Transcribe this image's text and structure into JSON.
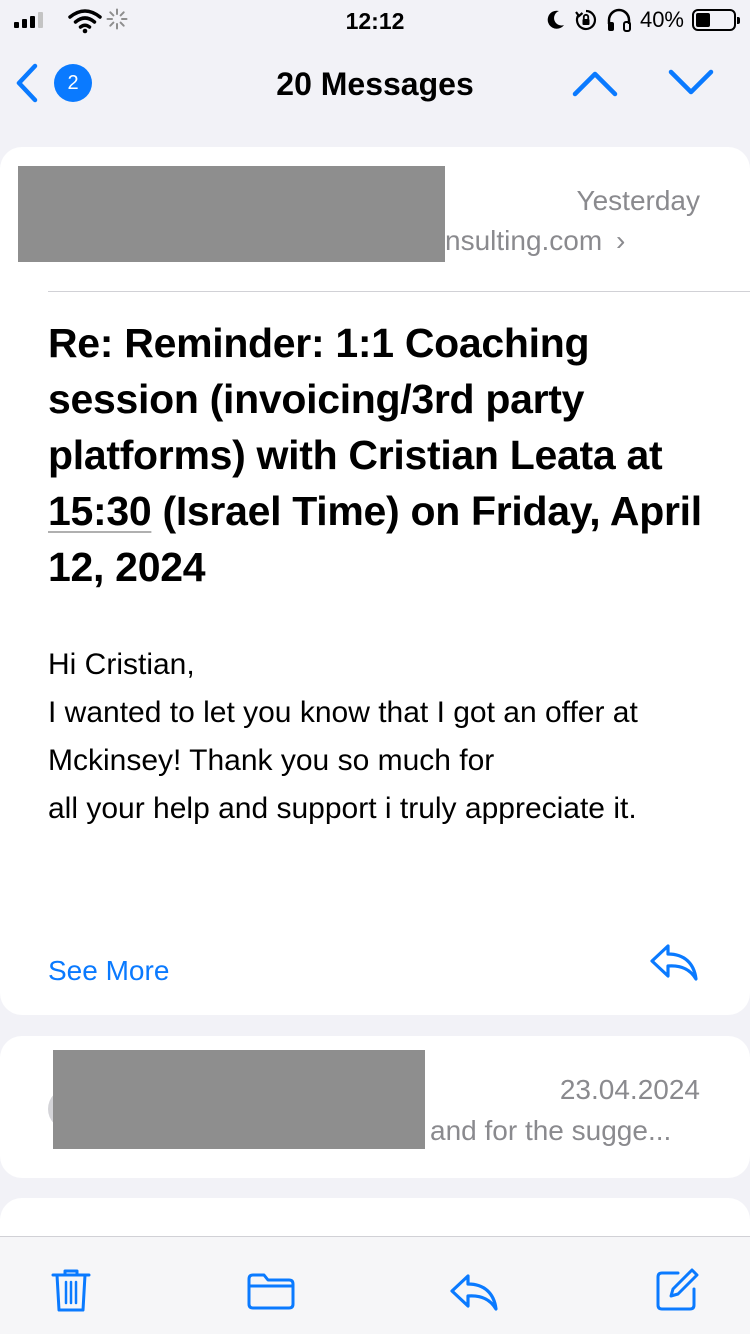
{
  "status_bar": {
    "time": "12:12",
    "battery_percent_text": "40%",
    "battery_level": 0.4,
    "icons": [
      "signal-icon",
      "wifi-icon",
      "loading-icon",
      "moon-icon",
      "rotation-lock-icon",
      "headphones-icon",
      "battery-icon"
    ]
  },
  "nav": {
    "back_badge": "2",
    "title": "20 Messages",
    "icons": [
      "chevron-left-icon",
      "chevron-up-icon",
      "chevron-down-icon"
    ]
  },
  "message_expanded": {
    "date": "Yesterday",
    "sender_partial": "nsulting.com",
    "subject_before": "Re: Reminder: 1:1 Coaching session (invoicing/3rd party platforms) with Cristian Leata at ",
    "subject_time": "15:30",
    "subject_after": " (Israel Time) on Friday, April 12, 2024",
    "body_lines": [
      "Hi Cristian,",
      "I wanted to let you know that I got an offer at Mckinsey! Thank you so much for",
      "all your help and support i truly appreciate it."
    ],
    "see_more": "See More"
  },
  "message_collapsed": {
    "date": "23.04.2024",
    "snippet": "and for the sugge..."
  },
  "toolbar": {
    "icons": [
      "trash-icon",
      "folder-icon",
      "reply-icon",
      "compose-icon"
    ]
  },
  "colors": {
    "accent": "#0a7aff",
    "secondary_text": "#8a8a8e",
    "redaction": "#8e8e8e",
    "background": "#f2f2f7"
  }
}
